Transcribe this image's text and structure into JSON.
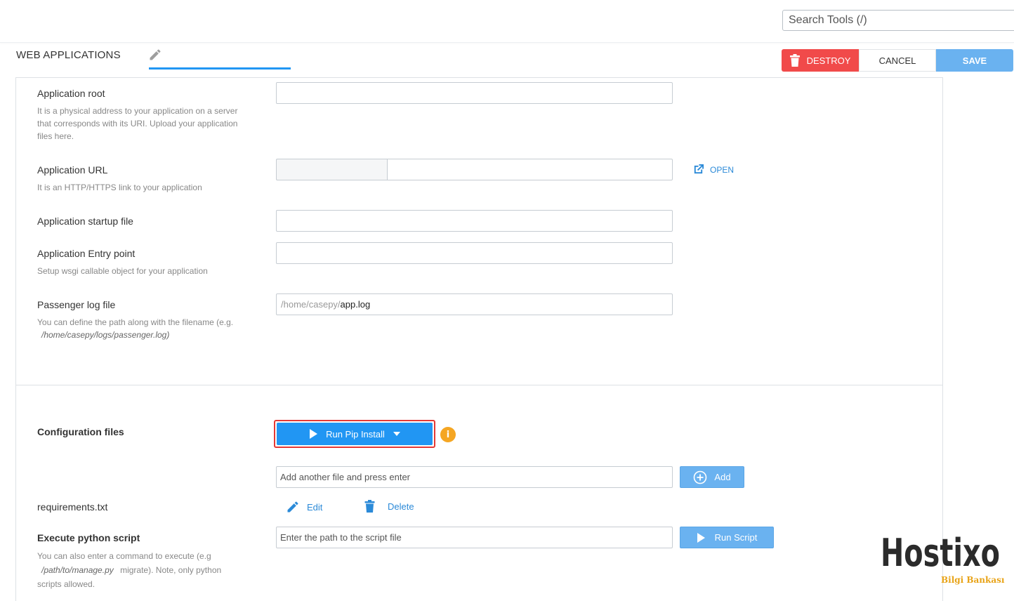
{
  "header": {
    "search_placeholder": "Search Tools (/)",
    "page_title": "WEB APPLICATIONS",
    "destroy_label": "DESTROY",
    "cancel_label": "CANCEL",
    "save_label": "SAVE"
  },
  "form": {
    "app_root": {
      "label": "Application root",
      "help": "It is a physical address to your application on a server that corresponds with its URI. Upload your application files here.",
      "value": ""
    },
    "app_url": {
      "label": "Application URL",
      "help": "It is an HTTP/HTTPS link to your application",
      "value": "",
      "open_label": "OPEN"
    },
    "startup_file": {
      "label": "Application startup file",
      "value": ""
    },
    "entry_point": {
      "label": "Application Entry point",
      "help": "Setup wsgi callable object for your application",
      "value": ""
    },
    "passenger_log": {
      "label": "Passenger log file",
      "help_prefix": "You can define the path along with the filename (e.g.",
      "help_example": "/home/casepy/logs/passenger.log)",
      "prefix": "/home/casepy/",
      "value": "app.log"
    }
  },
  "config": {
    "label": "Configuration files",
    "run_pip_label": "Run Pip Install",
    "add_file_placeholder": "Add another file and press enter",
    "add_label": "Add",
    "files": [
      {
        "name": "requirements.txt",
        "edit_label": "Edit",
        "delete_label": "Delete"
      }
    ],
    "execute": {
      "label": "Execute python script",
      "help_prefix": "You can also enter a command to execute (e.g",
      "help_example": "/path/to/manage.py",
      "help_suffix": "migrate). Note, only python scripts allowed.",
      "placeholder": "Enter the path to the script file",
      "run_label": "Run Script"
    }
  },
  "branding": {
    "logo_text": "Hostixo",
    "logo_subtext": "Bilgi Bankası"
  },
  "colors": {
    "primary": "#2196f3",
    "primary_light": "#6ab2f0",
    "danger": "#f14a4a",
    "warning": "#f5a623",
    "highlight_border": "#e53935"
  }
}
